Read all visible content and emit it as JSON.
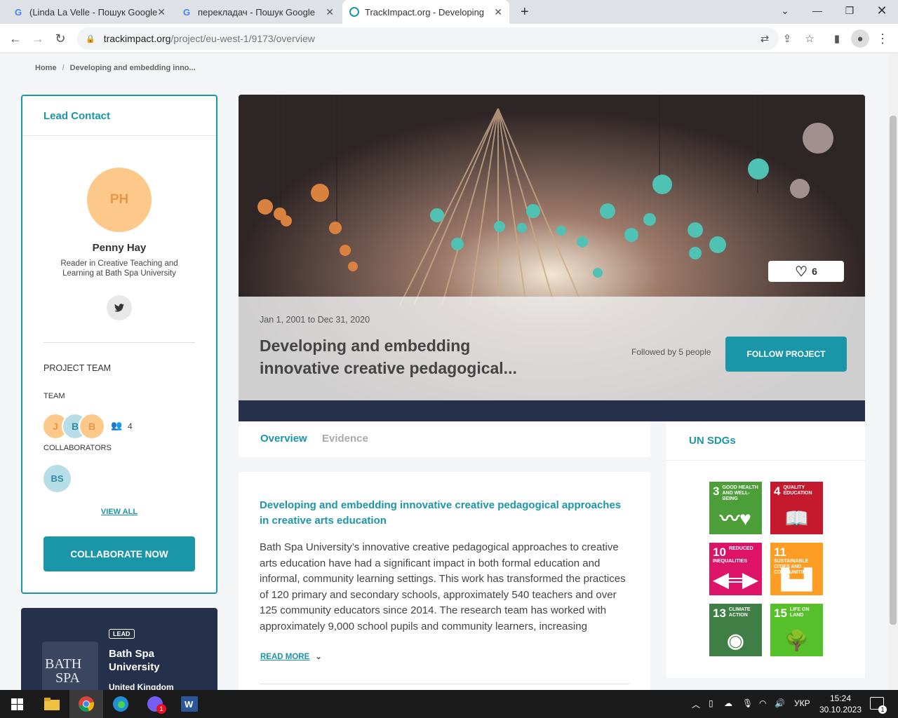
{
  "browser": {
    "tabs": [
      {
        "title": "(Linda La Velle - Пошук Google",
        "icon": "google-icon",
        "close": "✕"
      },
      {
        "title": "перекладач - Пошук Google",
        "icon": "google-icon",
        "close": "✕"
      },
      {
        "title": "TrackImpact.org - Developing an",
        "icon": "trackimpact-icon",
        "close": "✕"
      }
    ],
    "new_tab": "+",
    "url_domain": "trackimpact.org",
    "url_path": "/project/eu-west-1/9173/overview"
  },
  "breadcrumb": {
    "home": "Home",
    "sep": "/",
    "current": "Developing and embedding inno..."
  },
  "lead_contact": {
    "heading": "Lead Contact",
    "initials": "PH",
    "name": "Penny Hay",
    "role": "Reader in Creative Teaching and Learning at Bath Spa University"
  },
  "project_team": {
    "heading": "PROJECT TEAM",
    "team_label": "TEAM",
    "members": [
      "J",
      "B",
      "B"
    ],
    "count": "4",
    "collaborators_label": "COLLABORATORS",
    "collaborators": [
      "BS"
    ],
    "view_all": "VIEW ALL",
    "collaborate_button": "COLLABORATE NOW"
  },
  "organisation": {
    "badge": "LEAD",
    "name": "Bath Spa University",
    "country": "United Kingdom",
    "logo_text": "BATH SPA UNIVERSITY"
  },
  "project": {
    "likes": "6",
    "dates": "Jan 1, 2001 to Dec 31, 2020",
    "title": "Developing and embedding innovative creative pedagogical...",
    "followed_by": "Followed by 5 people",
    "follow_button": "FOLLOW PROJECT",
    "tabs": [
      "Overview",
      "Evidence"
    ],
    "full_title": "Developing and embedding innovative creative pedagogical approaches in creative arts education",
    "description": "Bath Spa University’s innovative creative pedagogical approaches to creative arts education have had a significant impact in both formal education and informal, community learning settings. This work has transformed the practices of 120 primary and secondary schools, approximately 540 teachers and over 125 community educators since 2014. The research team has worked with approximately 9,000 school pupils and community learners, increasing",
    "read_more": "READ MORE"
  },
  "sdgs": {
    "heading": "UN SDGs",
    "goals": [
      {
        "number": "3",
        "label": "GOOD HEALTH AND WELL-BEING",
        "color": "#4c9f38"
      },
      {
        "number": "4",
        "label": "QUALITY EDUCATION",
        "color": "#c5192d"
      },
      {
        "number": "10",
        "label": "REDUCED INEQUALITIES",
        "color": "#dd1367"
      },
      {
        "number": "11",
        "label": "SUSTAINABLE CITIES AND COMMUNITIES",
        "color": "#fd9d24"
      },
      {
        "number": "13",
        "label": "CLIMATE ACTION",
        "color": "#3f7e44"
      },
      {
        "number": "15",
        "label": "LIFE ON LAND",
        "color": "#56c02b"
      }
    ]
  },
  "taskbar": {
    "language": "УКР",
    "time": "15:24",
    "date": "30.10.2023",
    "viber_badge": "1",
    "notifications": "1"
  },
  "colors": {
    "accent": "#1b95a8",
    "dark_navy": "#26304a",
    "avatar_orange": "#fcc98a"
  }
}
